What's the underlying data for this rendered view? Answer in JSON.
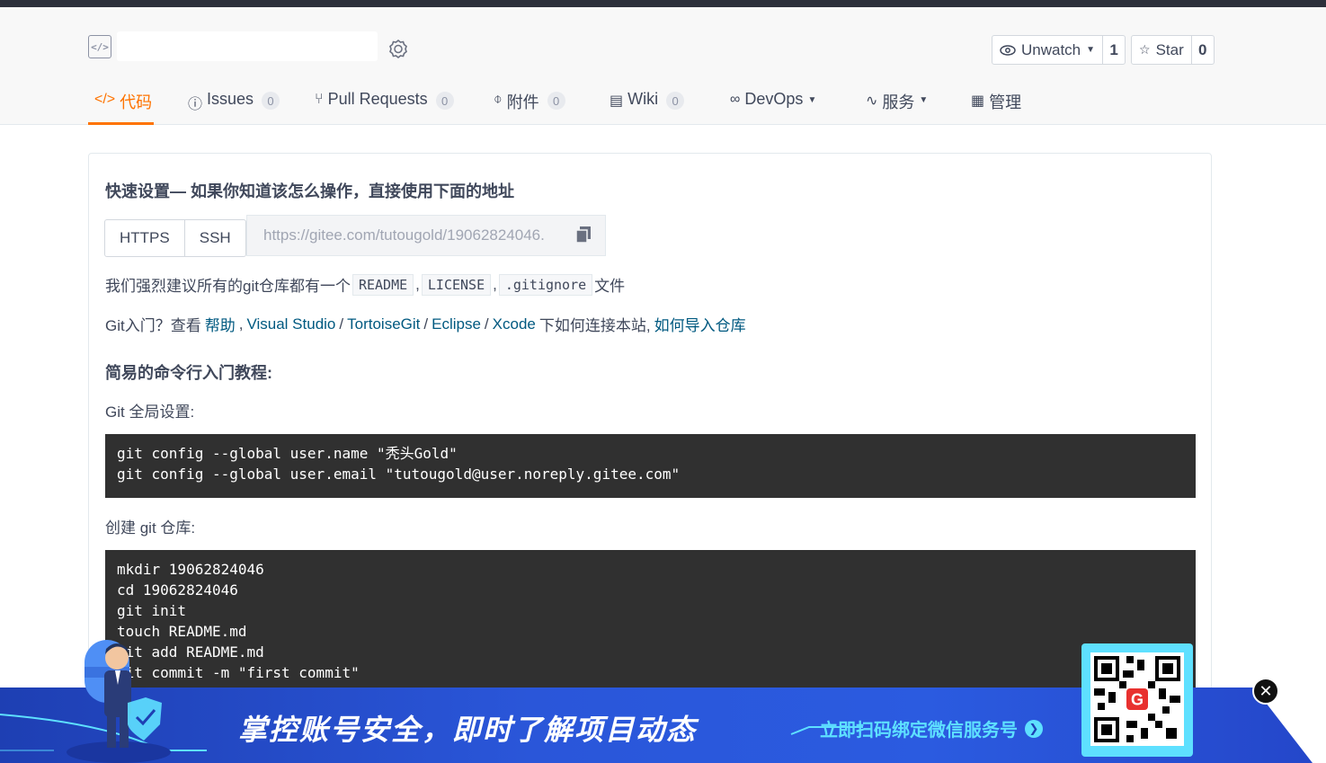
{
  "repo": {
    "icon_name": "code-repo-icon",
    "badge_icon": "award-badge-icon"
  },
  "actions": {
    "watch_label": "Unwatch",
    "watch_count": "1",
    "star_label": "Star",
    "star_count": "0"
  },
  "tabs": [
    {
      "label": "代码",
      "icon": "code-icon",
      "count": null
    },
    {
      "label": "Issues",
      "icon": "issue-icon",
      "count": "0"
    },
    {
      "label": "Pull Requests",
      "icon": "pull-request-icon",
      "count": "0"
    },
    {
      "label": "附件",
      "icon": "attachment-icon",
      "count": "0"
    },
    {
      "label": "Wiki",
      "icon": "wiki-icon",
      "count": "0"
    },
    {
      "label": "DevOps",
      "icon": "devops-icon",
      "count": null
    },
    {
      "label": "服务",
      "icon": "pulse-icon",
      "count": null
    },
    {
      "label": "管理",
      "icon": "settings-doc-icon",
      "count": null
    }
  ],
  "quick_setup": {
    "title": "快速设置— 如果你知道该怎么操作，直接使用下面的地址",
    "https_label": "HTTPS",
    "ssh_label": "SSH",
    "url": "https://gitee.com/tutougold/19062824046."
  },
  "recommend": {
    "prefix": "我们强烈建议所有的git仓库都有一个",
    "readme": "README",
    "sep1": ",",
    "license": "LICENSE",
    "sep2": ",",
    "gitignore": ".gitignore",
    "suffix": "文件"
  },
  "help": {
    "prefix": "Git入门？查看",
    "help_link": "帮助",
    "sep1": ",",
    "vs_link": "Visual Studio",
    "sep2": "/",
    "tortoise_link": "TortoiseGit",
    "sep3": "/",
    "eclipse_link": "Eclipse",
    "sep4": "/",
    "xcode_link": "Xcode",
    "middle": "下如何连接本站,",
    "import_link": "如何导入仓库"
  },
  "tutorial": {
    "title": "简易的命令行入门教程:",
    "global_label": "Git 全局设置:",
    "global_code": "git config --global user.name \"秃头Gold\"\ngit config --global user.email \"tutougold@user.noreply.gitee.com\"",
    "create_label": "创建 git 仓库:",
    "create_code": "mkdir 19062824046\ncd 19062824046\ngit init\ntouch README.md\ngit add README.md\ngit commit -m \"first commit\""
  },
  "banner": {
    "headline": "掌控账号安全，即时了解项目动态",
    "cta": "立即扫码绑定微信服务号",
    "close_label": "✕",
    "colors": {
      "bg": "#2a56d9",
      "accent": "#5ee0ff"
    }
  }
}
